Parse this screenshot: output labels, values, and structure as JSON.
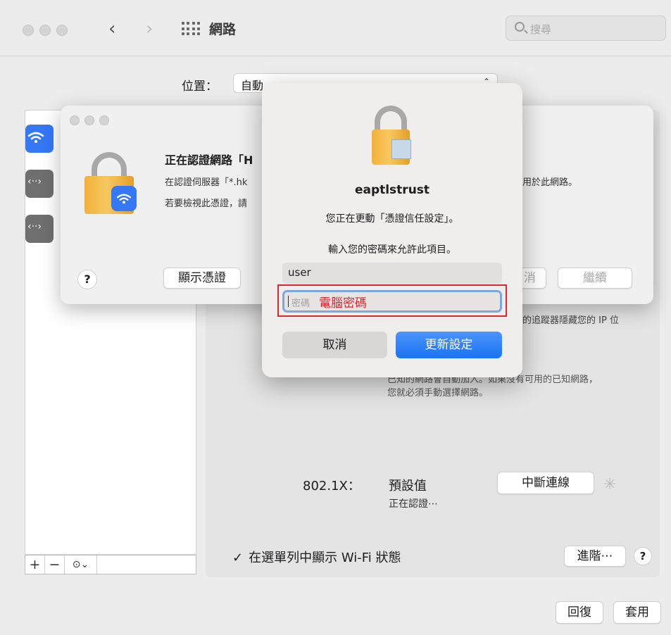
{
  "window": {
    "title": "網路",
    "search_placeholder": "搜尋",
    "location_label": "位置：",
    "location_value": "自動"
  },
  "main": {
    "ip_text": "的追蹤器隱藏您的 IP 位",
    "known_text_line1": "已知的網路會自動加入。如果沒有可用的已知網路，",
    "known_text_line2": "您就必須手動選擇網路。",
    "x8021_label": "802.1X：",
    "x8021_value": "預設值",
    "auth_status": "正在認證⋯",
    "disconnect_button": "中斷連線",
    "show_wifi_label": "在選單列中顯示 Wi‑Fi 狀態",
    "advanced_button": "進階⋯",
    "help_label": "?",
    "revert_button": "回復",
    "apply_button": "套用"
  },
  "cert_dialog": {
    "title": "正在認證網路「H",
    "line1": "在認證伺服器「*.hk",
    "line2": "若要檢視此憑證，請",
    "right_text": "用於此網路。",
    "help_label": "?",
    "show_cert_button": "顯示憑證",
    "cancel_partial": "消",
    "continue_button": "繼續"
  },
  "auth_dialog": {
    "title": "eaptlstrust",
    "message": "您正在更動「憑證信任設定」。",
    "prompt": "輸入您的密碼來允許此項目。",
    "username": "user",
    "password_placeholder": "密碼",
    "password_annotation": "電腦密碼",
    "cancel_button": "取消",
    "update_button": "更新設定"
  },
  "sidebar": {
    "add_label": "+",
    "remove_label": "−",
    "actions_label": "⊙⌄"
  },
  "colors": {
    "accent": "#1a73f1",
    "highlight": "#e0262e",
    "lock_gold": "#f2b13a"
  }
}
